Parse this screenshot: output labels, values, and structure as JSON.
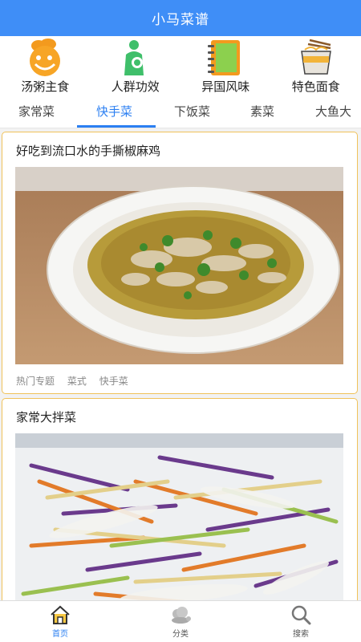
{
  "app": {
    "title": "小马菜谱"
  },
  "categories": [
    {
      "label": "汤粥主食",
      "icon": "smiling-bowl-icon"
    },
    {
      "label": "人群功效",
      "icon": "mother-baby-icon"
    },
    {
      "label": "异国风味",
      "icon": "notebook-icon"
    },
    {
      "label": "特色面食",
      "icon": "noodle-cup-icon"
    }
  ],
  "tabs": [
    {
      "label": "家常菜"
    },
    {
      "label": "快手菜",
      "active": true
    },
    {
      "label": "下饭菜"
    },
    {
      "label": "素菜"
    },
    {
      "label": "大鱼大"
    }
  ],
  "feed": {
    "cards": [
      {
        "title": "好吃到流口水的手撕椒麻鸡",
        "tags": [
          "热门专题",
          "菜式",
          "快手菜"
        ]
      },
      {
        "title": "家常大拌菜"
      }
    ]
  },
  "bottom_nav": [
    {
      "label": "首页",
      "icon": "home-icon",
      "active": true
    },
    {
      "label": "分类",
      "icon": "category-icon"
    },
    {
      "label": "搜索",
      "icon": "search-icon"
    }
  ],
  "colors": {
    "brand": "#3f8ef7",
    "active_tab": "#2b7ff2",
    "card_border": "#f0c25a"
  }
}
